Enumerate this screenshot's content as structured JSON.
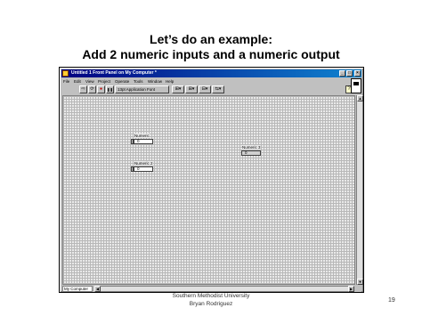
{
  "slide": {
    "title_line1": "Let’s do an example:",
    "title_line2": "Add 2 numeric inputs and a numeric output"
  },
  "window": {
    "title": "Untitled 1 Front Panel on My Computer *",
    "minimize_glyph": "_",
    "maximize_glyph": "□",
    "close_glyph": "×"
  },
  "menu": [
    "File",
    "Edit",
    "View",
    "Project",
    "Operate",
    "Tools",
    "Window",
    "Help"
  ],
  "toolbar": {
    "run_glyph": "⇨",
    "run_continuous_glyph": "⟳",
    "abort_glyph": "●",
    "pause_glyph": "❚❚",
    "font_select": "13pt Application Font",
    "align_glyph": "⊞▾",
    "distribute_glyph": "⊞▾",
    "resize_glyph": "⊟▾",
    "reorder_glyph": "⇆▾",
    "help_glyph": "?"
  },
  "controls": [
    {
      "label": "Numeric",
      "value": "0",
      "kind": "control"
    },
    {
      "label": "Numeric 2",
      "value": "0",
      "kind": "control"
    },
    {
      "label": "Numeric 3",
      "value": "0",
      "kind": "indicator"
    }
  ],
  "statusbar": {
    "context": "My Computer"
  },
  "footer": {
    "line1": "Southern Methodist University",
    "line2": "Bryan Rodriguez",
    "page": "19"
  }
}
